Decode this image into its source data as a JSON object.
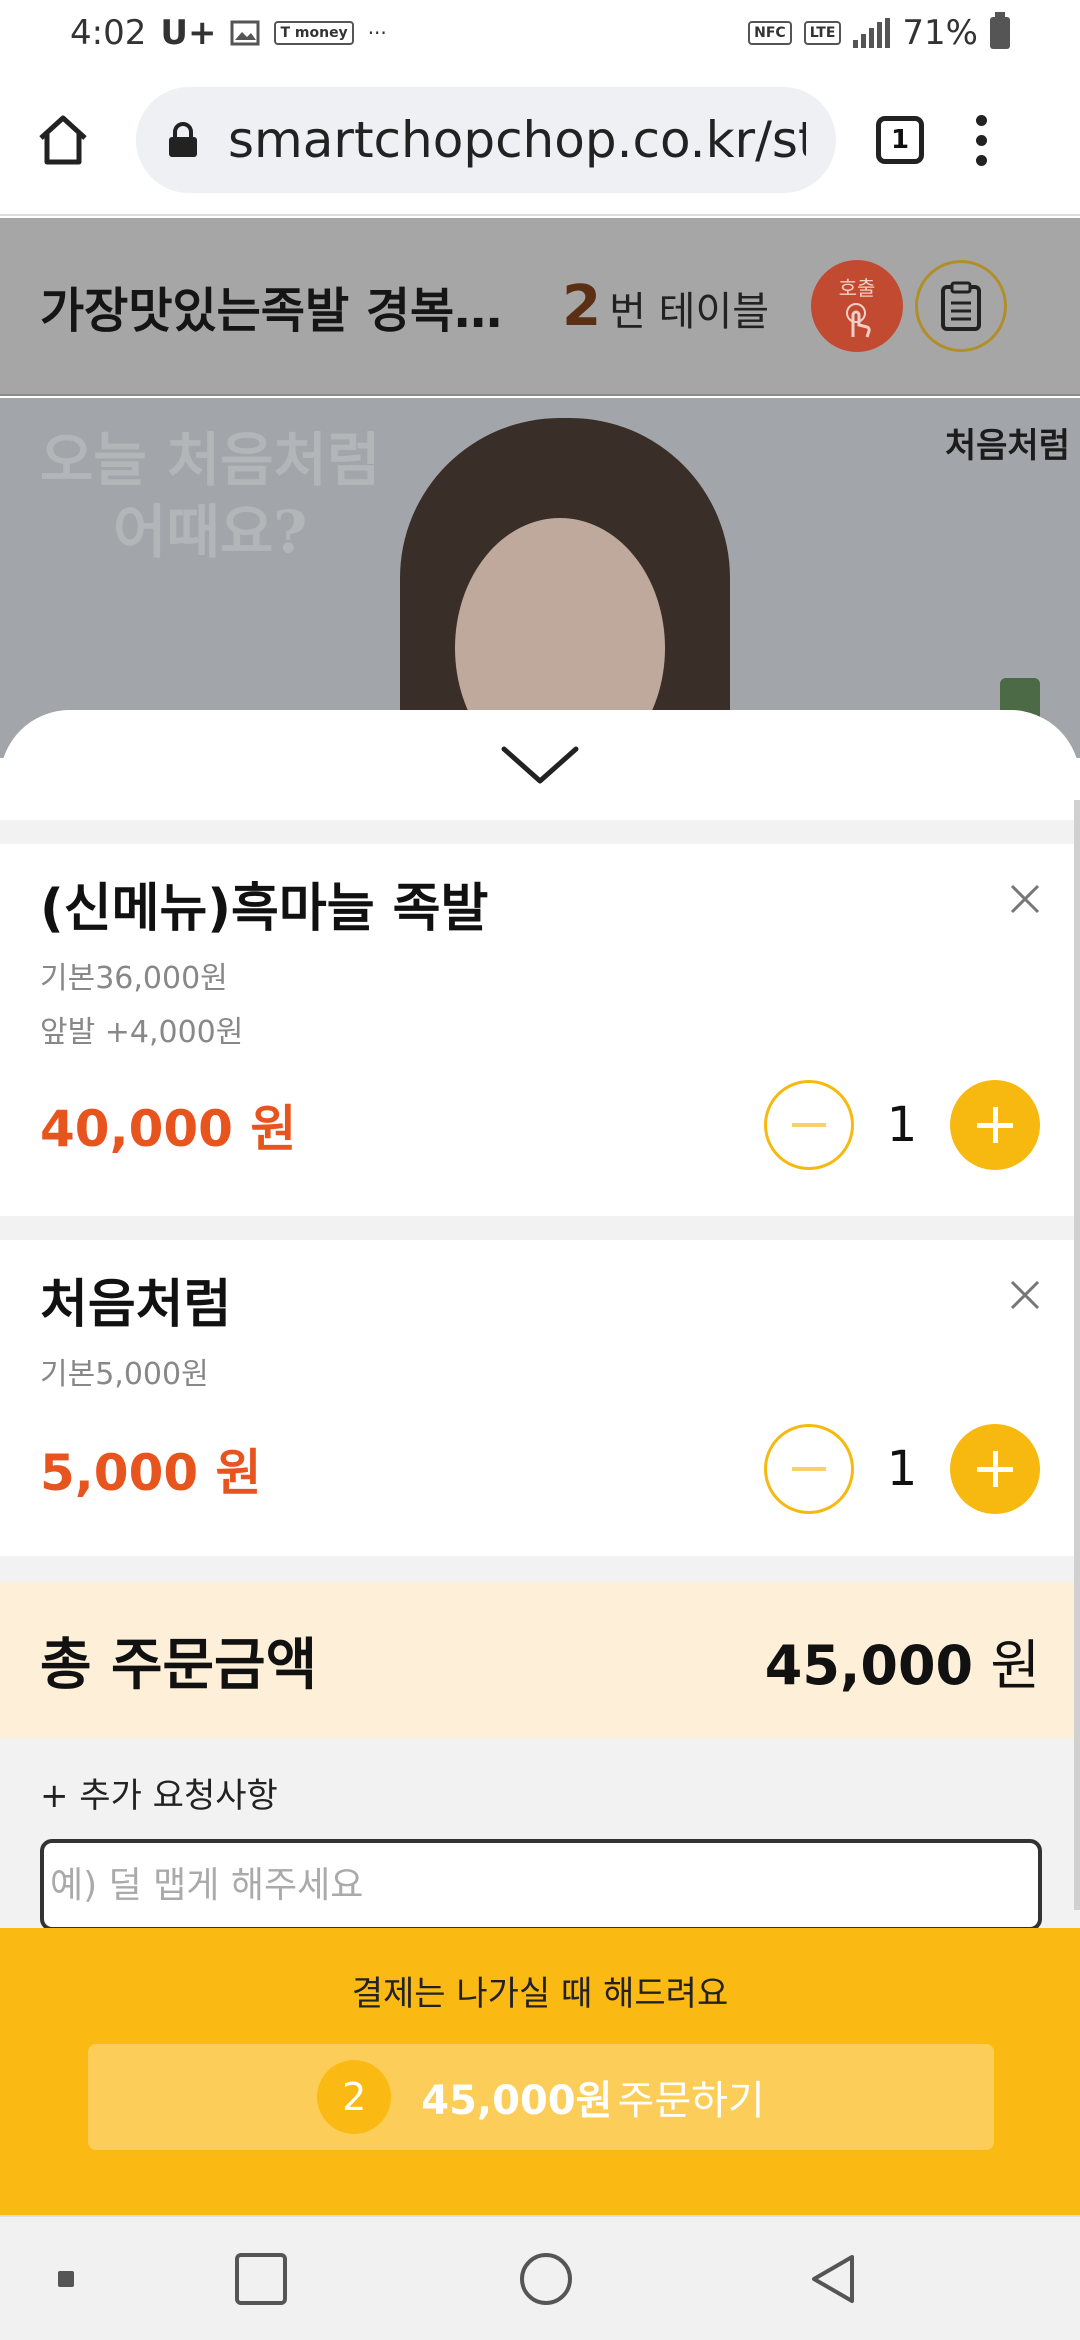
{
  "status_bar": {
    "time": "4:02",
    "carrier": "U+",
    "app_badge": "T money",
    "more": "···",
    "nfc": "NFC",
    "lte": "LTE",
    "battery": "71%"
  },
  "browser": {
    "url": "smartchopchop.co.kr/st",
    "tab_count": "1"
  },
  "header": {
    "store_name": "가장맛있는족발 경복…",
    "table_number": "2",
    "table_label": "번 테이블",
    "call_label": "호출"
  },
  "banner": {
    "copy_line1": "오늘 처음처럼",
    "copy_line2": "어때요?",
    "logo": "처음처럼"
  },
  "cart": {
    "items": [
      {
        "name": "(신메뉴)흑마늘 족발",
        "base": "기본36,000원",
        "option": "앞발 +4,000원",
        "price": "40,000 원",
        "quantity": "1"
      },
      {
        "name": "처음처럼",
        "base": "기본5,000원",
        "price": "5,000 원",
        "quantity": "1"
      }
    ],
    "total_label": "총 주문금액",
    "total_amount": "45,000",
    "total_unit": "원"
  },
  "request": {
    "label": "+ 추가 요청사항",
    "placeholder": "예) 덜 맵게 해주세요",
    "value": ""
  },
  "order": {
    "pay_note": "결제는 나가실 때 해드려요",
    "count": "2",
    "amount": "45,000원",
    "label": "주문하기"
  },
  "colors": {
    "accent": "#fbb914",
    "price": "#e8541e",
    "total_bg": "#fdefd8"
  }
}
